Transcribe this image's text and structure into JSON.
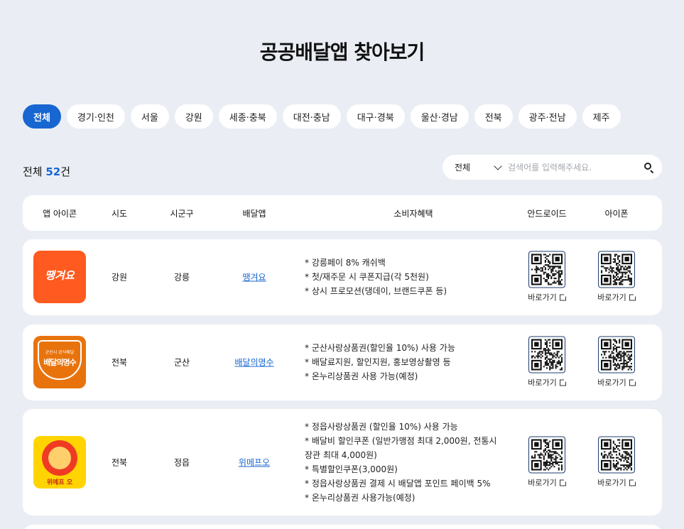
{
  "page": {
    "title": "공공배달앱 찾아보기"
  },
  "tabs": [
    "전체",
    "경기·인천",
    "서울",
    "강원",
    "세종·충북",
    "대전·충남",
    "대구·경북",
    "울산·경남",
    "전북",
    "광주·전남",
    "제주"
  ],
  "summary": {
    "prefix": "전체 ",
    "count": "52",
    "suffix": "건"
  },
  "search": {
    "select_value": "전체",
    "placeholder": "검색어를 입력해주세요."
  },
  "table": {
    "headers": [
      "앱 아이콘",
      "시도",
      "시군구",
      "배달앱",
      "소비자혜택",
      "안드로이드",
      "아이폰"
    ],
    "link_label": "바로가기",
    "rows": [
      {
        "sido": "강원",
        "sigungu": "강릉",
        "app": "땡겨요",
        "logo_text": "땡겨요",
        "logo_color": "#ff5a1f",
        "benefits": [
          "* 강릉페이 8% 캐쉬백",
          "* 첫/재주문 시 쿠폰지급(각 5천원)",
          "* 상시 프로모션(댕데이, 브랜드쿠폰 등)"
        ]
      },
      {
        "sido": "전북",
        "sigungu": "군산",
        "app": "배달의명수",
        "logo_text": "배달의명수",
        "logo_sub": "군산시 공식배달",
        "logo_color": "#e8730c",
        "benefits": [
          "* 군산사랑상품권(할인율 10%) 사용 가능",
          "* 배달료지원, 할인지원, 홍보영상촬영 등",
          "* 온누리상품권 사용 가능(예정)"
        ]
      },
      {
        "sido": "전북",
        "sigungu": "정읍",
        "app": "위메프오",
        "logo_text": "위메프 오",
        "logo_color": "#ffd400",
        "benefits": [
          "* 정읍사랑상품권 (할인율 10%) 사용 가능",
          "* 배달비 할인쿠폰 (일반가맹점 최대 2,000원, 전통시",
          "장관 최대 4,000원)",
          "* 특별할인쿠폰(3,000원)",
          "* 정읍사랑상품권 결제 시 배달앱 포인트 페이백 5%",
          "* 온누리상품권 사용가능(예정)"
        ]
      }
    ]
  }
}
